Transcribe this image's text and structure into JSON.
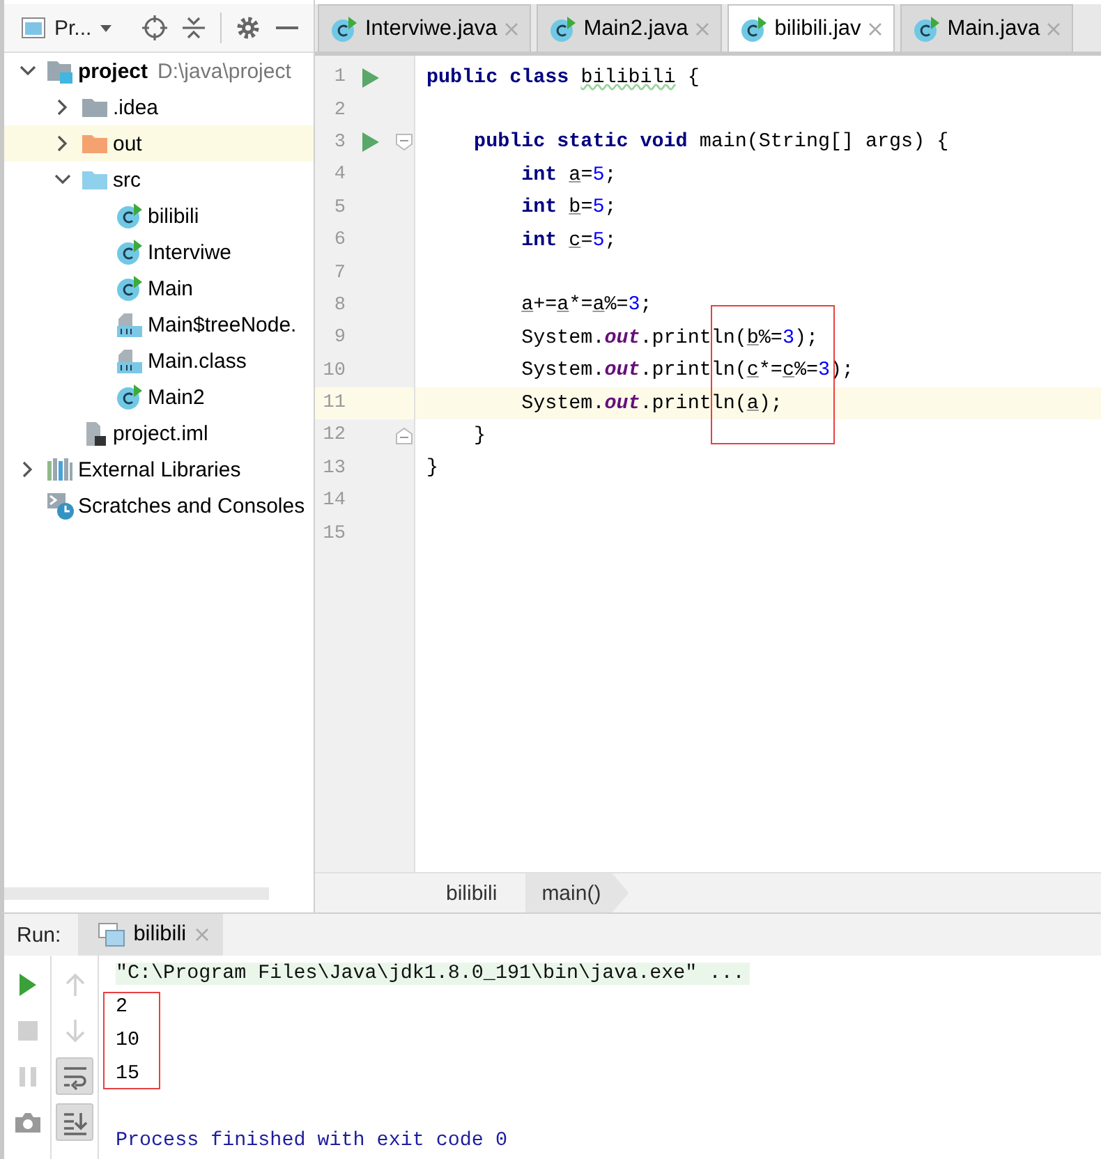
{
  "project_panel": {
    "title": "Pr...",
    "tree": [
      {
        "kind": "module",
        "name": "project",
        "path": "D:\\java\\project",
        "expanded": true,
        "selected": false,
        "children": [
          {
            "kind": "folder",
            "name": ".idea",
            "expanded": false,
            "selected": false
          },
          {
            "kind": "excluded-folder",
            "name": "out",
            "expanded": false,
            "selected": true
          },
          {
            "kind": "source-folder",
            "name": "src",
            "expanded": true,
            "selected": false,
            "children": [
              {
                "kind": "class",
                "name": "bilibili",
                "selected": false
              },
              {
                "kind": "class",
                "name": "Interviwe",
                "selected": false
              },
              {
                "kind": "class",
                "name": "Main",
                "selected": false
              },
              {
                "kind": "classfile",
                "name": "Main$treeNode.",
                "selected": false
              },
              {
                "kind": "classfile",
                "name": "Main.class",
                "selected": false
              },
              {
                "kind": "class",
                "name": "Main2",
                "selected": false
              }
            ]
          },
          {
            "kind": "iml",
            "name": "project.iml",
            "selected": false
          }
        ]
      },
      {
        "kind": "libraries",
        "name": "External Libraries",
        "expanded": false,
        "selected": false
      },
      {
        "kind": "scratches",
        "name": "Scratches and Consoles",
        "selected": false
      }
    ]
  },
  "tabs": [
    {
      "label": "Interviwe.java",
      "selected": false
    },
    {
      "label": "Main2.java",
      "selected": false
    },
    {
      "label": "bilibili.jav",
      "selected": true
    },
    {
      "label": "Main.java",
      "selected": false
    }
  ],
  "editor": {
    "lines": [
      {
        "number": "1",
        "run": true,
        "current": false,
        "tokens": [
          {
            "kind": "keyword",
            "text": "public class "
          },
          {
            "kind": "typo",
            "text": "bilibili"
          },
          {
            "kind": "plain",
            "text": " {"
          }
        ]
      },
      {
        "number": "2",
        "run": false,
        "current": false
      },
      {
        "number": "3",
        "run": true,
        "fold": {
          "kind": "start"
        },
        "current": false,
        "tokens": [
          {
            "kind": "keyword",
            "text": "    public static void"
          },
          {
            "kind": "plain",
            "text": " main(String[] args) {"
          }
        ]
      },
      {
        "number": "4",
        "run": false,
        "current": false,
        "tokens": [
          {
            "kind": "keyword",
            "text": "        int "
          },
          {
            "kind": "variable",
            "text": "a"
          },
          {
            "kind": "plain",
            "text": "="
          },
          {
            "kind": "number",
            "text": "5"
          },
          {
            "kind": "plain",
            "text": ";"
          }
        ]
      },
      {
        "number": "5",
        "run": false,
        "current": false,
        "tokens": [
          {
            "kind": "keyword",
            "text": "        int "
          },
          {
            "kind": "variable",
            "text": "b"
          },
          {
            "kind": "plain",
            "text": "="
          },
          {
            "kind": "number",
            "text": "5"
          },
          {
            "kind": "plain",
            "text": ";"
          }
        ]
      },
      {
        "number": "6",
        "run": false,
        "current": false,
        "tokens": [
          {
            "kind": "keyword",
            "text": "        int "
          },
          {
            "kind": "variable",
            "text": "c"
          },
          {
            "kind": "plain",
            "text": "="
          },
          {
            "kind": "number",
            "text": "5"
          },
          {
            "kind": "plain",
            "text": ";"
          }
        ]
      },
      {
        "number": "7",
        "run": false,
        "current": false
      },
      {
        "number": "8",
        "run": false,
        "current": false,
        "tokens": [
          {
            "kind": "variable",
            "text": "        a"
          },
          {
            "kind": "plain",
            "text": "+="
          },
          {
            "kind": "variable",
            "text": "a"
          },
          {
            "kind": "plain",
            "text": "*="
          },
          {
            "kind": "variable",
            "text": "a"
          },
          {
            "kind": "plain",
            "text": "%="
          },
          {
            "kind": "number",
            "text": "3"
          },
          {
            "kind": "plain",
            "text": ";"
          }
        ]
      },
      {
        "number": "9",
        "run": false,
        "current": false,
        "tokens": [
          {
            "kind": "plain",
            "text": "        System."
          },
          {
            "kind": "field",
            "text": "out"
          },
          {
            "kind": "plain",
            "text": ".println("
          },
          {
            "kind": "variable",
            "text": "b"
          },
          {
            "kind": "plain",
            "text": "%="
          },
          {
            "kind": "number",
            "text": "3"
          },
          {
            "kind": "plain",
            "text": ");"
          }
        ]
      },
      {
        "number": "10",
        "run": false,
        "current": false,
        "tokens": [
          {
            "kind": "plain",
            "text": "        System."
          },
          {
            "kind": "field",
            "text": "out"
          },
          {
            "kind": "plain",
            "text": ".println("
          },
          {
            "kind": "variable",
            "text": "c"
          },
          {
            "kind": "plain",
            "text": "*="
          },
          {
            "kind": "variable",
            "text": "c"
          },
          {
            "kind": "plain",
            "text": "%="
          },
          {
            "kind": "number",
            "text": "3"
          },
          {
            "kind": "plain",
            "text": ");"
          }
        ]
      },
      {
        "number": "11",
        "run": false,
        "current": true,
        "tokens": [
          {
            "kind": "plain",
            "text": "        System."
          },
          {
            "kind": "field",
            "text": "out"
          },
          {
            "kind": "plain",
            "text": ".println("
          },
          {
            "kind": "variable",
            "text": "a"
          },
          {
            "kind": "plain",
            "text": ");"
          }
        ]
      },
      {
        "number": "12",
        "run": false,
        "fold": {
          "kind": "end"
        },
        "current": false,
        "tokens": [
          {
            "kind": "plain",
            "text": "    }"
          }
        ]
      },
      {
        "number": "13",
        "run": false,
        "current": false,
        "tokens": [
          {
            "kind": "plain",
            "text": "}"
          }
        ]
      },
      {
        "number": "14",
        "run": false,
        "current": false
      },
      {
        "number": "15",
        "run": false,
        "current": false
      }
    ],
    "markup_box": {
      "kind": "code"
    },
    "breadcrumbs": [
      "bilibili",
      "main()"
    ]
  },
  "run_panel": {
    "label": "Run:",
    "tab": {
      "label": "bilibili",
      "selected": true
    },
    "left_toolbar": [
      {
        "kind": "run",
        "disabled": false
      },
      {
        "kind": "stop",
        "disabled": true
      },
      {
        "kind": "pause",
        "disabled": true
      },
      {
        "kind": "camera",
        "disabled": false
      }
    ],
    "right_toolbar": [
      {
        "kind": "up",
        "disabled": true,
        "on": false
      },
      {
        "kind": "down",
        "disabled": true,
        "on": false
      },
      {
        "kind": "wrap",
        "disabled": false,
        "on": true
      },
      {
        "kind": "scroll-end",
        "disabled": false,
        "on": true
      }
    ],
    "console": [
      {
        "kind": "command",
        "text": "\"C:\\Program Files\\Java\\jdk1.8.0_191\\bin\\java.exe\" ..."
      },
      {
        "kind": "output",
        "text": "2"
      },
      {
        "kind": "output",
        "text": "10"
      },
      {
        "kind": "output",
        "text": "15"
      },
      {
        "kind": "blank"
      },
      {
        "kind": "system",
        "text": "Process finished with exit code 0"
      }
    ],
    "markup_box": {
      "kind": "console"
    }
  }
}
